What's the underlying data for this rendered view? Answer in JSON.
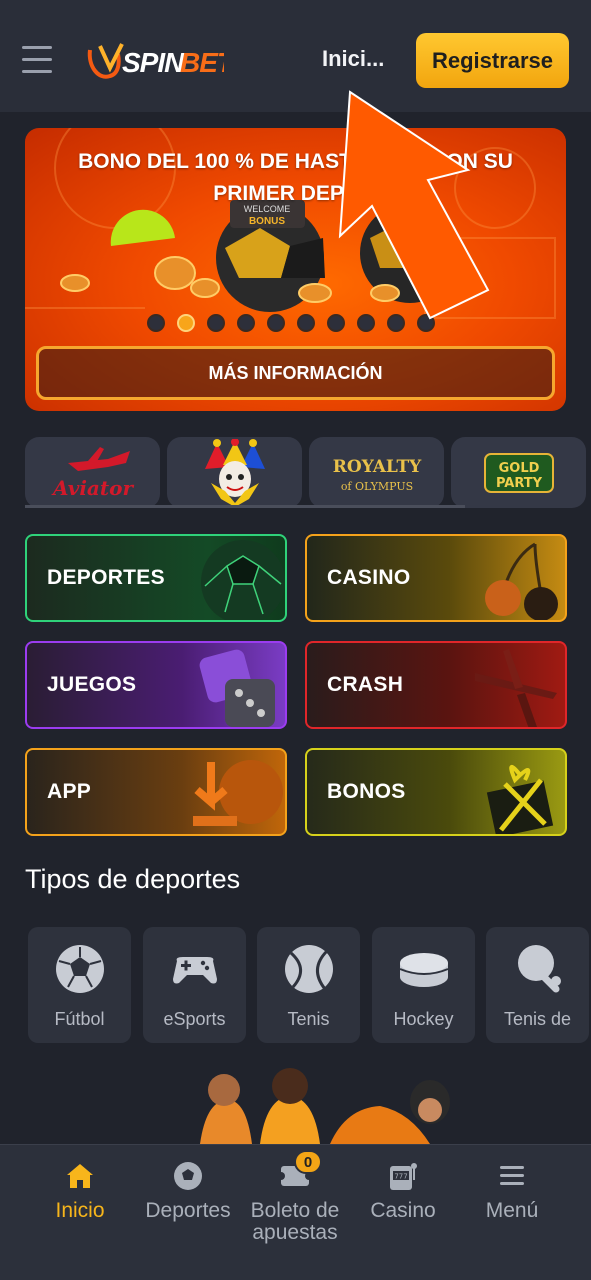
{
  "header": {
    "logo_text": "JVSPINBET",
    "nav_inicio": "Inici...",
    "register_label": "Registrarse"
  },
  "banner": {
    "title": "BONO DEL 100 % DE HASTA ... OR CON SU PRIMER DEPÓ...",
    "more_label": "MÁS INFORMACIÓN",
    "slide_count": 10,
    "active_slide": 2
  },
  "games": [
    {
      "name": "Aviator"
    },
    {
      "name": "Joker"
    },
    {
      "name": "ROYALTY of OLYMPUS"
    },
    {
      "name": "GOLD PARTY"
    }
  ],
  "categories": [
    {
      "label": "DEPORTES",
      "border": "#2fd27a",
      "icon": "soccer-ball-icon"
    },
    {
      "label": "CASINO",
      "border": "#f4a21b",
      "icon": "cherries-icon"
    },
    {
      "label": "JUEGOS",
      "border": "#9b3cf0",
      "icon": "dice-icon"
    },
    {
      "label": "CRASH",
      "border": "#e0262a",
      "icon": "airplane-icon"
    },
    {
      "label": "APP",
      "border": "#f4a21b",
      "icon": "download-icon"
    },
    {
      "label": "BONOS",
      "border": "#d6d11b",
      "icon": "gift-icon"
    }
  ],
  "sports_section": {
    "title": "Tipos de deportes",
    "items": [
      {
        "label": "Fútbol",
        "icon": "soccer-ball-icon"
      },
      {
        "label": "eSports",
        "icon": "gamepad-icon"
      },
      {
        "label": "Tenis",
        "icon": "tennis-ball-icon"
      },
      {
        "label": "Hockey",
        "icon": "hockey-puck-icon"
      },
      {
        "label": "Tenis de",
        "icon": "ping-pong-icon"
      }
    ]
  },
  "bottom_nav": {
    "items": [
      {
        "label": "Inicio",
        "icon": "home-icon",
        "active": true
      },
      {
        "label": "Deportes",
        "icon": "soccer-ball-icon"
      },
      {
        "label": "Boleto de apuestas",
        "icon": "ticket-icon"
      },
      {
        "label": "Casino",
        "icon": "slot-machine-icon"
      },
      {
        "label": "Menú",
        "icon": "menu-icon"
      }
    ],
    "bet_count": "0"
  },
  "colors": {
    "accent": "#f7b51b",
    "background": "#20232c",
    "header": "#2a2e39"
  }
}
